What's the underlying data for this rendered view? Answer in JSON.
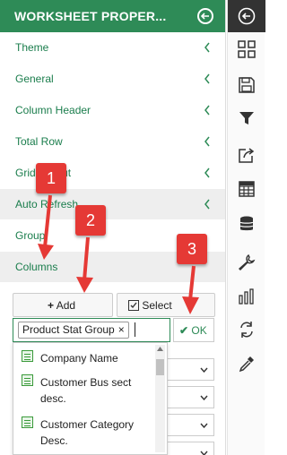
{
  "panel": {
    "title": "WORKSHEET PROPER...",
    "menu": [
      {
        "label": "Theme"
      },
      {
        "label": "General"
      },
      {
        "label": "Column Header"
      },
      {
        "label": "Total Row"
      },
      {
        "label": "Grid Layout"
      },
      {
        "label": "Auto Refresh"
      },
      {
        "label": "Group"
      },
      {
        "label": "Columns"
      }
    ]
  },
  "annotations": [
    "1",
    "2",
    "3"
  ],
  "columns": {
    "add_label": "Add",
    "select_label": "Select",
    "tag_label": "Product Stat Group",
    "tag_remove": "×",
    "ok_label": "OK",
    "dropdown_items": [
      "Company Name",
      "Customer Bus sect desc.",
      "Customer Category Desc."
    ]
  },
  "toolbar_icons": [
    "collapse-icon",
    "dashboard-icon",
    "save-icon",
    "filter-icon",
    "export-icon",
    "table-icon",
    "database-icon",
    "wrench-icon",
    "chart-icon",
    "refresh-icon",
    "eyedropper-icon"
  ],
  "colors": {
    "accent": "#2e8b57",
    "annotation": "#e53935",
    "link": "#1a7d4c"
  }
}
